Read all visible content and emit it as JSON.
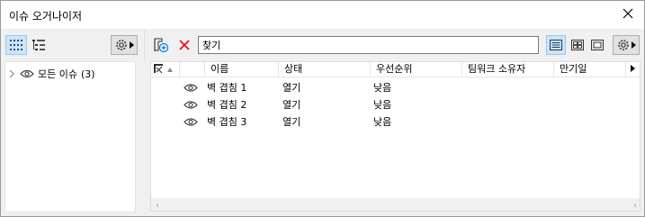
{
  "window": {
    "title": "이슈 오거나이저"
  },
  "left_panel": {
    "tree": [
      {
        "label": "모든 이슈",
        "count": "(3)"
      }
    ]
  },
  "right_panel": {
    "search": {
      "placeholder": "찾기",
      "value": "찾기"
    },
    "columns": [
      "이름",
      "상태",
      "우선순위",
      "팀워크 소유자",
      "만기일"
    ],
    "rows": [
      {
        "name": "벽 겹침 1",
        "status": "열기",
        "priority": "낮음",
        "owner": "",
        "due": ""
      },
      {
        "name": "벽 겹침 2",
        "status": "열기",
        "priority": "낮음",
        "owner": "",
        "due": ""
      },
      {
        "name": "벽 겹침 3",
        "status": "열기",
        "priority": "낮음",
        "owner": "",
        "due": ""
      }
    ]
  },
  "colors": {
    "accent": "#0078d7",
    "delete_red": "#e81123",
    "active_bg": "#cce4f7"
  },
  "icons": {
    "view_list": "list-view-icon",
    "view_grid": "grid-view-icon",
    "view_detail": "detail-view-icon",
    "settings": "gear-icon",
    "add_issue": "add-issue-icon",
    "delete": "delete-icon",
    "visibility": "eye-icon"
  }
}
